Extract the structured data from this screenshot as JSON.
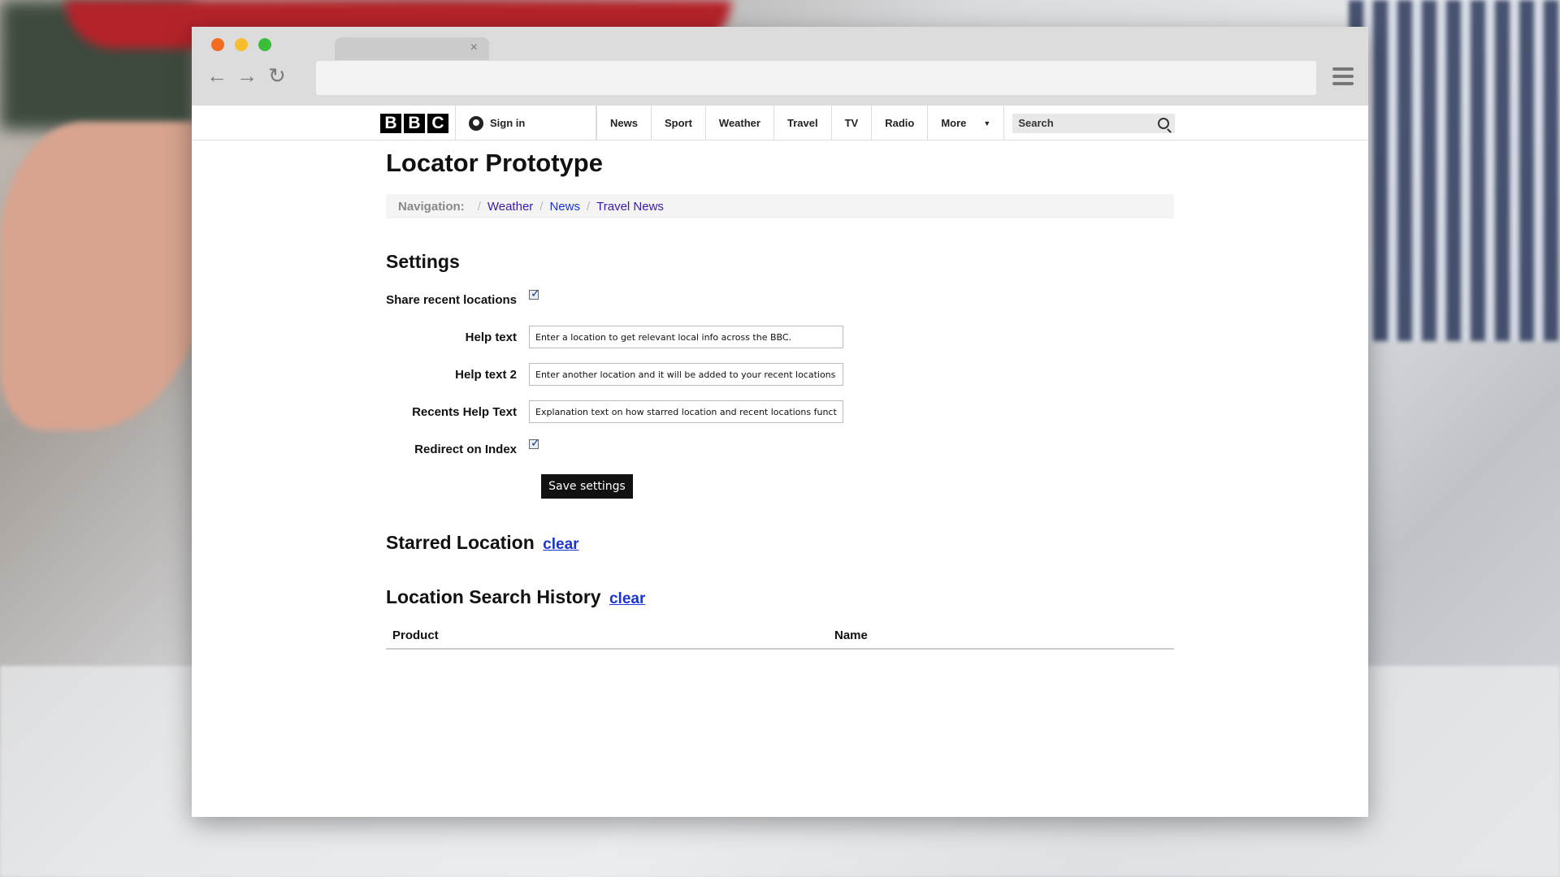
{
  "browser": {
    "tab_close": "×",
    "nav_back": "←",
    "nav_forward": "→",
    "nav_reload": "↻"
  },
  "bbc_nav": {
    "logo_letters": [
      "B",
      "B",
      "C"
    ],
    "signin_label": "Sign in",
    "links": [
      "News",
      "Sport",
      "Weather",
      "Travel",
      "TV",
      "Radio"
    ],
    "more_label": "More",
    "search_placeholder": "Search"
  },
  "page": {
    "title": "Locator Prototype",
    "breadcrumb": {
      "label": "Navigation:",
      "items": [
        "Weather",
        "News",
        "Travel News"
      ]
    },
    "settings": {
      "heading": "Settings",
      "share_label": "Share recent locations",
      "share_checked": true,
      "help_label": "Help text",
      "help_value": "Enter a location to get relevant local info across the BBC.",
      "help2_label": "Help text 2",
      "help2_value": "Enter another location and it will be added to your recent locations",
      "recents_label": "Recents Help Text",
      "recents_value": "Explanation text on how starred location and recent locations functio",
      "redirect_label": "Redirect on Index",
      "redirect_checked": true,
      "save_label": "Save settings"
    },
    "starred": {
      "heading": "Starred Location",
      "clear_label": "clear"
    },
    "history": {
      "heading": "Location Search History",
      "clear_label": "clear",
      "columns": [
        "Product",
        "Name"
      ]
    }
  }
}
